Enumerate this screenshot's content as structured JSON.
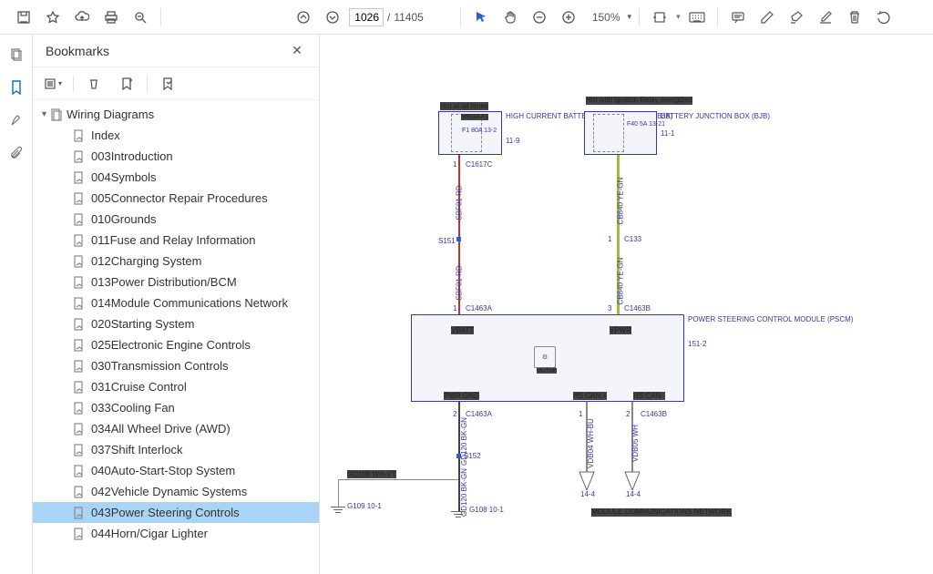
{
  "toolbar": {
    "page_current": "1026",
    "page_total": "11405",
    "zoom": "150%"
  },
  "sidebar": {
    "title": "Bookmarks",
    "root": "Wiring Diagrams",
    "items": [
      "Index",
      "003Introduction",
      "004Symbols",
      "005Connector Repair Procedures",
      "010Grounds",
      "011Fuse and Relay Information",
      "012Charging System",
      "013Power Distribution/BCM",
      "014Module Communications Network",
      "020Starting System",
      "025Electronic Engine Controls",
      "030Transmission Controls",
      "031Cruise Control",
      "033Cooling Fan",
      "034All Wheel Drive (AWD)",
      "037Shift Interlock",
      "040Auto-Start-Stop System",
      "042Vehicle Dynamic Systems",
      "043Power Steering Controls",
      "044Horn/Cigar Lighter"
    ],
    "active_index": 18
  },
  "diagram": {
    "hot_all": "Hot at all times",
    "hot_ign": "Hot with Ignition Relay energized",
    "hcbj": "HIGH CURRENT BATTERY JUNCTION BOX (BJB)",
    "hcbj_ref": "11-9",
    "bjb": "BATTERY JUNCTION BOX (BJB)",
    "bjb_ref": "11-1",
    "mega": "MEGA F1",
    "f1": "F1 80A 13-2",
    "f40": "F40 5A 13-21",
    "c1617c": "C1617C",
    "sbf01a": "SBF01 RD",
    "s151": "S151",
    "sbf01b": "SBF01 RD",
    "c1463a1": "C1463A",
    "cb840a": "CB840 YE-GN",
    "c133": "C133",
    "cb840b": "CB840 YE-GN",
    "c1463b1": "C1463B",
    "pscm": "POWER STEERING CONTROL MODULE (PSCM)",
    "pscm_ref": "151-2",
    "vbatt": "VBATT",
    "vpwr": "VPWR",
    "motor": "MOTOR",
    "pwr_gnd": "PWR GND",
    "hscanp": "HS CAN +",
    "hscanm": "HS CAN -",
    "c1463a2": "C1463A",
    "gd120a": "GD120 BK-GN",
    "s152": "S152",
    "gd120b": "GD120 BK-GN",
    "gd108": "GD108  WH-VT",
    "g109": "G109 10-1",
    "g108": "G108 10-1",
    "c1463b2": "C1463B",
    "vdb04": "VDB04 WH-BU",
    "vdb05": "VDB05 WH",
    "r14_4a": "14-4",
    "r14_4b": "14-4",
    "mcn": "MODULE COMMUNICATIONS NETWORK",
    "n1": "1",
    "n2": "2",
    "n3": "3"
  }
}
